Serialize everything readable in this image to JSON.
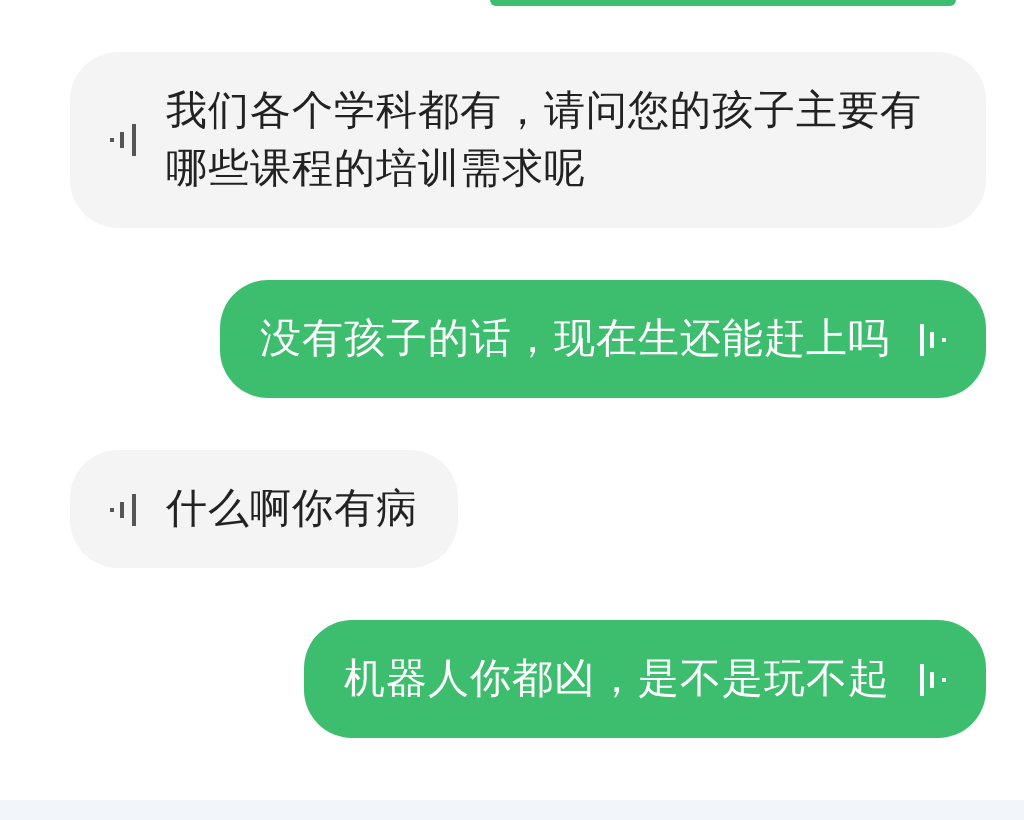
{
  "messages": [
    {
      "kind": "incoming",
      "text": "我们各个学科都有，请问您的孩子主要有哪些课程的培训需求呢"
    },
    {
      "kind": "outgoing",
      "text": "没有孩子的话，现在生还能赶上吗"
    },
    {
      "kind": "incoming",
      "text": "什么啊你有病"
    },
    {
      "kind": "outgoing",
      "text": "机器人你都凶，是不是玩不起"
    }
  ]
}
